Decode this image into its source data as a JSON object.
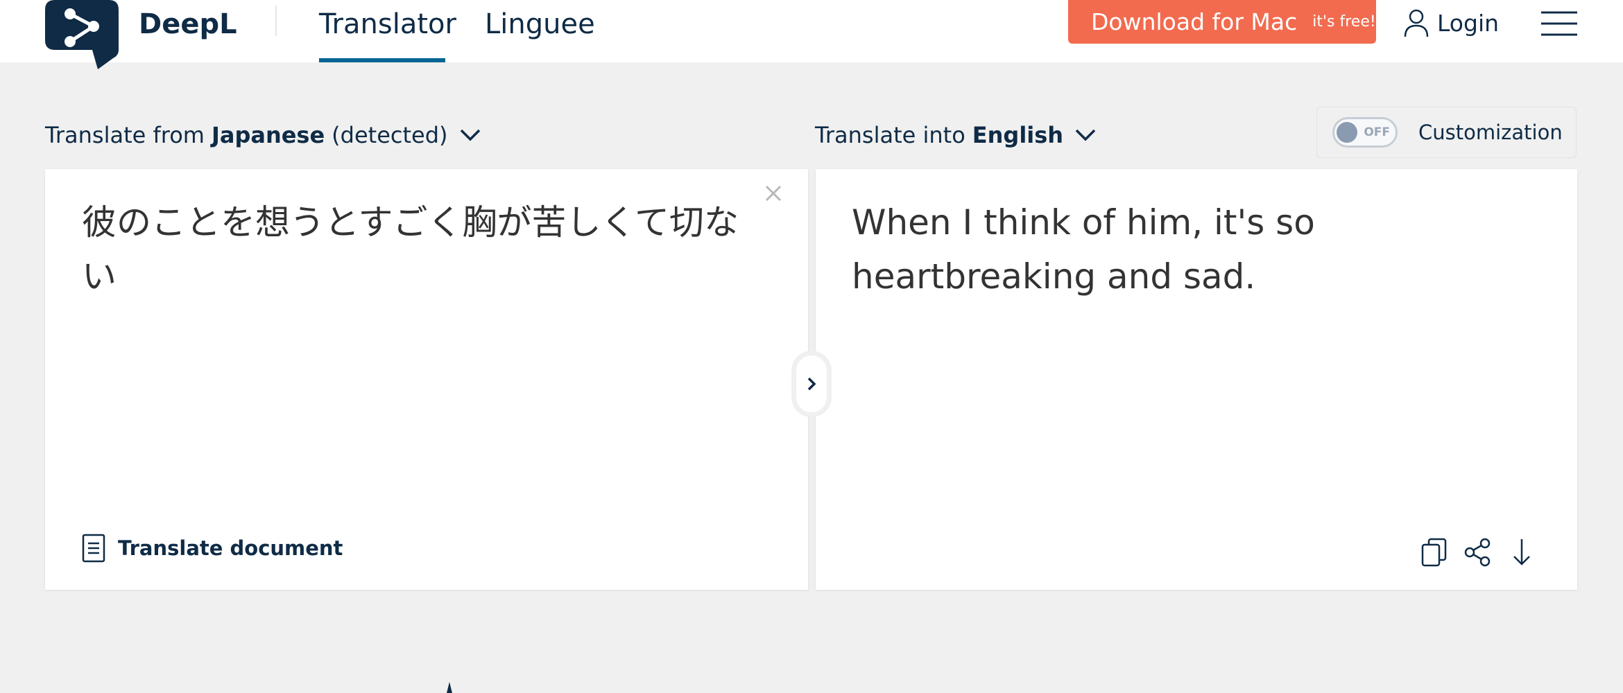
{
  "header": {
    "brand": "DeepL",
    "logo_icon": "deepl-logo-icon",
    "nav": {
      "translator": "Translator",
      "linguee": "Linguee",
      "active": "Translator"
    },
    "download": {
      "label": "Download for Mac",
      "sub": "it's free!"
    },
    "login": {
      "label": "Login",
      "icon": "user-icon"
    },
    "menu_icon": "hamburger-menu-icon"
  },
  "lang_bar": {
    "from_prefix": "Translate from",
    "from_language": "Japanese",
    "from_detected": "(detected)",
    "into_prefix": "Translate into",
    "into_language": "English",
    "customization": {
      "toggle_state": "OFF",
      "label": "Customization"
    }
  },
  "source_panel": {
    "text": "彼のことを想うとすごく胸が苦しくて切ない",
    "translate_document_label": "Translate document",
    "clear_icon": "close-icon"
  },
  "target_panel": {
    "text": "When I think of him, it's so heartbreaking and sad.",
    "tools": [
      "copy-icon",
      "share-icon",
      "download-icon"
    ]
  },
  "colors": {
    "brand_navy": "#0f2b46",
    "accent_blue": "#006494",
    "download_orange": "#f26b4f",
    "background": "#f0f0f0"
  }
}
